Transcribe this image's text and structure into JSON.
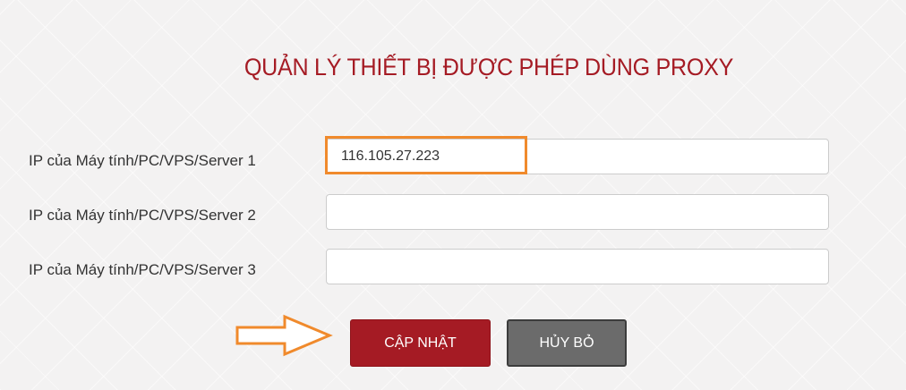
{
  "page": {
    "title": "QUẢN LÝ THIẾT BỊ ĐƯỢC PHÉP DÙNG PROXY"
  },
  "form": {
    "fields": [
      {
        "label": "IP của Máy tính/PC/VPS/Server 1",
        "value": "116.105.27.223",
        "placeholder": ""
      },
      {
        "label": "IP của Máy tính/PC/VPS/Server 2",
        "value": "",
        "placeholder": ""
      },
      {
        "label": "IP của Máy tính/PC/VPS/Server 3",
        "value": "",
        "placeholder": ""
      }
    ]
  },
  "actions": {
    "update_label": "CẬP NHẬT",
    "cancel_label": "HỦY BỎ"
  },
  "annotations": {
    "highlight_color": "#f08a2c",
    "arrow_icon": "right-arrow-icon"
  },
  "colors": {
    "accent": "#a51b24",
    "secondary_button": "#6b6b6b"
  }
}
